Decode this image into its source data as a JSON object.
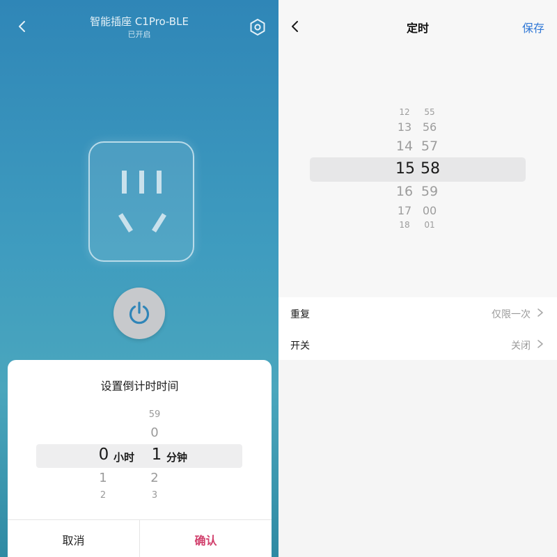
{
  "device": {
    "title": "智能插座 C1Pro-BLE",
    "status": "已开启",
    "icons": {
      "back": "chevron-left-icon",
      "settings": "hexagon-settings-icon",
      "socket": "socket-icon",
      "power": "power-icon"
    }
  },
  "countdown_dialog": {
    "title": "设置倒计时时间",
    "hours": {
      "above": [
        "",
        ""
      ],
      "selected": "0",
      "below": [
        "1",
        "2"
      ],
      "unit": "小时"
    },
    "minutes": {
      "above": [
        "59",
        "0"
      ],
      "selected": "1",
      "below": [
        "2",
        "3"
      ],
      "unit": "分钟"
    },
    "cancel_label": "取消",
    "confirm_label": "确认",
    "confirm_color": "#d13f6c"
  },
  "timer": {
    "title": "定时",
    "save_label": "保存",
    "accent_color": "#2f77d6",
    "hours": {
      "above": [
        "12",
        "13",
        "14"
      ],
      "selected": "15",
      "below": [
        "16",
        "17",
        "18"
      ]
    },
    "minutes": {
      "above": [
        "55",
        "56",
        "57"
      ],
      "selected": "58",
      "below": [
        "59",
        "00",
        "01"
      ]
    },
    "rows": [
      {
        "label": "重复",
        "value": "仅限一次"
      },
      {
        "label": "开关",
        "value": "关闭"
      }
    ]
  }
}
